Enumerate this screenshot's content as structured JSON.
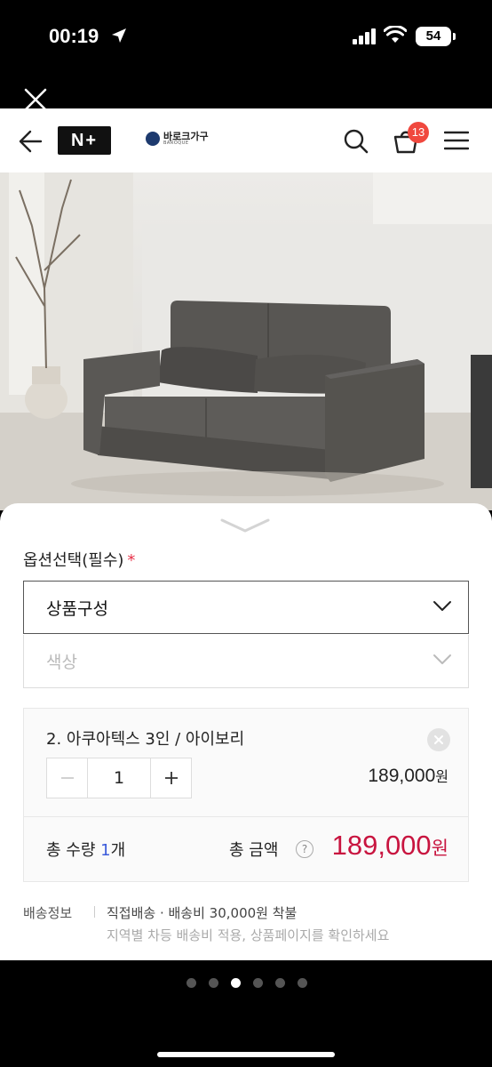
{
  "status_bar": {
    "time": "00:19",
    "battery": "54"
  },
  "header": {
    "logo_text": "N+",
    "brand_ko": "바로크가구",
    "brand_en": "BAROQUE",
    "cart_count": "13"
  },
  "product": {
    "image_alt": "sofa"
  },
  "options": {
    "title": "옵션선택(필수)",
    "required_mark": "*",
    "primary_select": "상품구성",
    "secondary_select": "색상"
  },
  "selected_item": {
    "name": "2. 아쿠아텍스 3인 / 아이보리",
    "quantity": "1",
    "price": "189,000",
    "currency": "원"
  },
  "totals": {
    "qty_label": "총 수량 ",
    "qty_value": "1",
    "qty_unit": "개",
    "amount_label": "총 금액",
    "help": "?",
    "amount": "189,000",
    "currency": "원"
  },
  "delivery": {
    "label": "배송정보",
    "main": "직접배송 · 배송비 30,000원 착불",
    "sub": "지역별 차등 배송비 적용, 상품페이지를 확인하세요"
  },
  "pager": {
    "count": 6,
    "active_index": 2
  }
}
